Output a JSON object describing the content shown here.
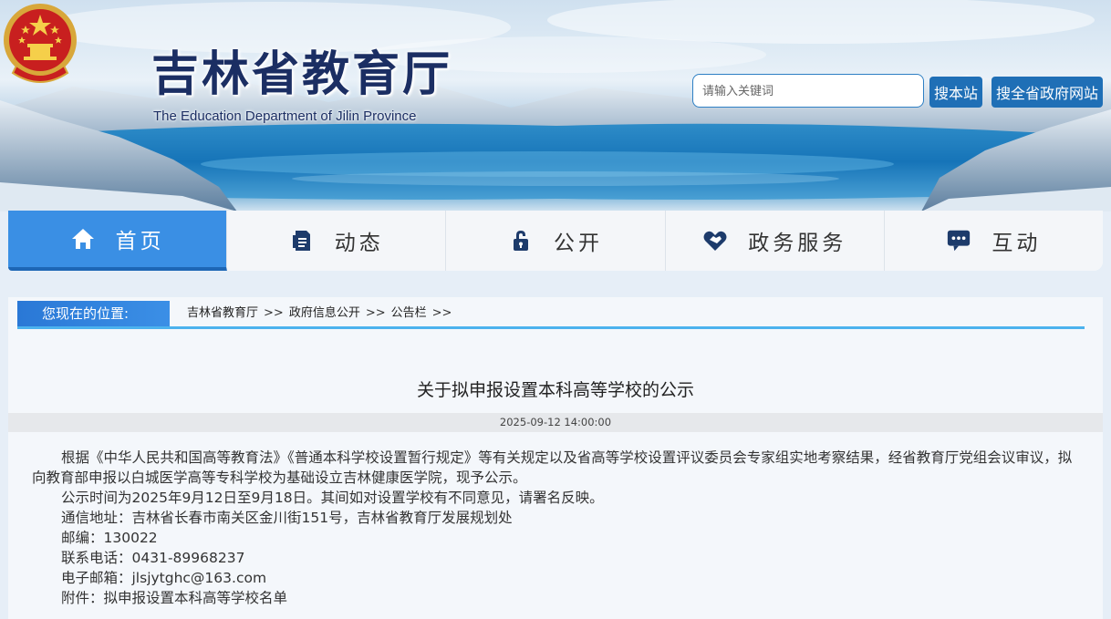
{
  "header": {
    "title": "吉林省教育厅",
    "subtitle": "The Education Department of Jilin Province",
    "emblem_icon": "national-emblem-icon"
  },
  "search": {
    "placeholder": "请输入关键词",
    "site_button": "搜本站",
    "province_button": "搜全省政府网站"
  },
  "nav": {
    "items": [
      {
        "label": "首页",
        "icon": "home-icon",
        "active": true
      },
      {
        "label": "动态",
        "icon": "document-icon"
      },
      {
        "label": "公开",
        "icon": "lock-icon"
      },
      {
        "label": "政务服务",
        "icon": "handshake-heart-icon"
      },
      {
        "label": "互动",
        "icon": "chat-bubble-icon"
      }
    ]
  },
  "breadcrumb": {
    "label": "您现在的位置:",
    "items": [
      "吉林省教育厅",
      "政府信息公开",
      "公告栏"
    ],
    "separator": ">>"
  },
  "article": {
    "title": "关于拟申报设置本科高等学校的公示",
    "date": "2025-09-12 14:00:00",
    "paragraph1": "根据《中华人民共和国高等教育法》《普通本科学校设置暂行规定》等有关规定以及省高等学校设置评议委员会专家组实地考察结果，经省教育厅党组会议审议，拟向教育部申报以白城医学高等专科学校为基础设立吉林健康医学院，现予公示。",
    "paragraph2": "公示时间为2025年9月12日至9月18日。其间如对设置学校有不同意见，请署名反映。",
    "address": "通信地址：吉林省长春市南关区金川街151号，吉林省教育厅发展规划处",
    "postcode": "邮编：130022",
    "phone": "联系电话：0431-89968237",
    "email": "电子邮箱：jlsjytghc@163.com",
    "attachment": "附件：拟申报设置本科高等学校名单"
  },
  "colors": {
    "nav_active": "#3a8fe4",
    "button_blue": "#1f6fb6",
    "title_navy": "#1b2e63",
    "breadcrumb_rule": "#4cb2ee"
  }
}
